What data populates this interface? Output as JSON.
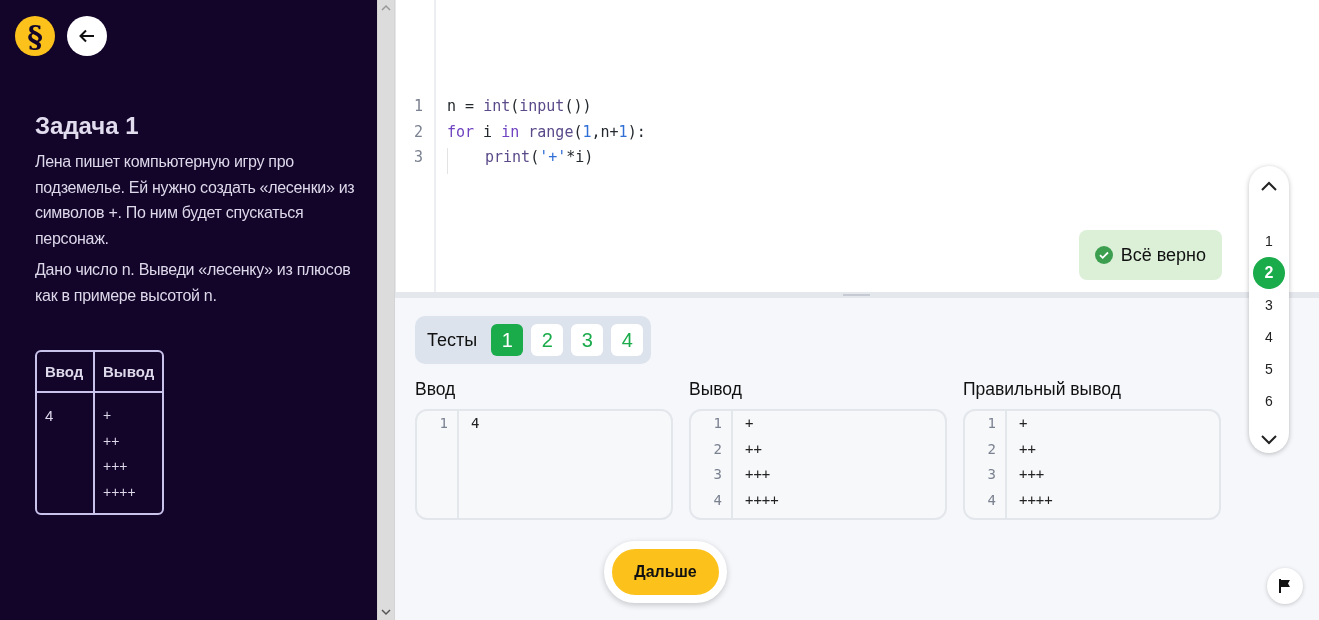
{
  "sidebar": {
    "logo": "§",
    "task_title": "Задача 1",
    "statement": [
      "Лена пишет компьютерную игру про подземелье. Ей нужно создать «лесенки» из символов +. По ним будет спускаться персонаж.",
      "Дано число n. Выведи «лесенку» из плюсов как в примере высотой n."
    ],
    "example_table": {
      "columns": [
        "Ввод",
        "Вывод"
      ],
      "rows": [
        {
          "input": "4",
          "output": [
            "+",
            "++",
            "+++",
            "++++"
          ]
        }
      ]
    }
  },
  "editor": {
    "lines": [
      {
        "number": "1",
        "indent": false,
        "tokens": [
          {
            "kind": "plain",
            "text": "n = "
          },
          {
            "kind": "builtin",
            "text": "int"
          },
          {
            "kind": "plain",
            "text": "("
          },
          {
            "kind": "builtin",
            "text": "input"
          },
          {
            "kind": "plain",
            "text": "())"
          }
        ]
      },
      {
        "number": "2",
        "indent": false,
        "tokens": [
          {
            "kind": "keyword",
            "text": "for"
          },
          {
            "kind": "plain",
            "text": " i "
          },
          {
            "kind": "keyword",
            "text": "in"
          },
          {
            "kind": "builtin",
            "text": " range"
          },
          {
            "kind": "plain",
            "text": "("
          },
          {
            "kind": "number",
            "text": "1"
          },
          {
            "kind": "plain",
            "text": ",n+"
          },
          {
            "kind": "number",
            "text": "1"
          },
          {
            "kind": "plain",
            "text": "):"
          }
        ]
      },
      {
        "number": "3",
        "indent": true,
        "tokens": [
          {
            "kind": "builtin",
            "text": "print"
          },
          {
            "kind": "plain",
            "text": "("
          },
          {
            "kind": "string",
            "text": "'+'"
          },
          {
            "kind": "plain",
            "text": "*i)"
          }
        ]
      }
    ],
    "status": {
      "kind": "success",
      "text": "Всё верно"
    }
  },
  "task_nav": {
    "items": [
      {
        "label": "1",
        "selected": false
      },
      {
        "label": "2",
        "selected": true
      },
      {
        "label": "3",
        "selected": false
      },
      {
        "label": "4",
        "selected": false
      },
      {
        "label": "5",
        "selected": false
      },
      {
        "label": "6",
        "selected": false
      }
    ]
  },
  "tests": {
    "label": "Тесты",
    "tabs": [
      {
        "label": "1",
        "selected": true
      },
      {
        "label": "2",
        "selected": false
      },
      {
        "label": "3",
        "selected": false
      },
      {
        "label": "4",
        "selected": false
      }
    ],
    "panels": [
      {
        "title": "Ввод",
        "lines": [
          {
            "number": "1",
            "text": "4"
          }
        ]
      },
      {
        "title": "Вывод",
        "lines": [
          {
            "number": "1",
            "text": "+"
          },
          {
            "number": "2",
            "text": "++"
          },
          {
            "number": "3",
            "text": "+++"
          },
          {
            "number": "4",
            "text": "++++"
          }
        ]
      },
      {
        "title": "Правильный вывод",
        "lines": [
          {
            "number": "1",
            "text": "+"
          },
          {
            "number": "2",
            "text": "++"
          },
          {
            "number": "3",
            "text": "+++"
          },
          {
            "number": "4",
            "text": "++++"
          }
        ]
      }
    ]
  },
  "next_button": "Дальше"
}
